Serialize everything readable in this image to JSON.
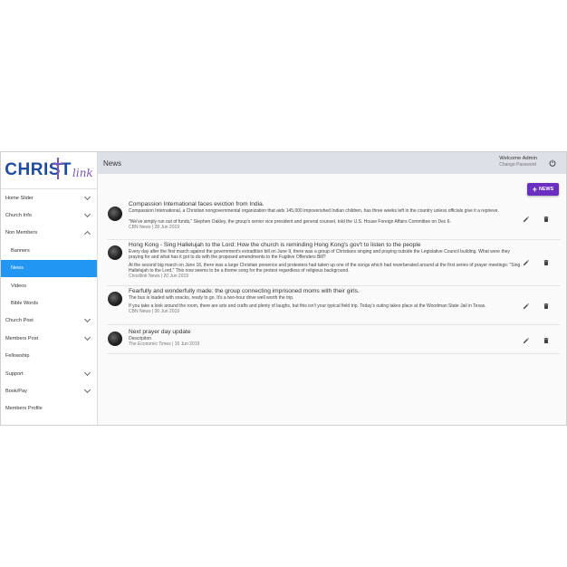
{
  "logo": {
    "main": "CHRIST",
    "script": "link"
  },
  "sidebar": {
    "items": [
      {
        "label": "Home Slider",
        "chevron": "down"
      },
      {
        "label": "Church Info",
        "chevron": "down"
      },
      {
        "label": "Non Members",
        "chevron": "up"
      },
      {
        "label": "Banners",
        "sub": true
      },
      {
        "label": "News",
        "sub": true,
        "active": true
      },
      {
        "label": "Videos",
        "sub": true
      },
      {
        "label": "Bible Words",
        "sub": true
      },
      {
        "label": "Church Post",
        "chevron": "down"
      },
      {
        "label": "Members Post",
        "chevron": "down"
      },
      {
        "label": "Fellowship"
      },
      {
        "label": "Support",
        "chevron": "down"
      },
      {
        "label": "Book/Pay",
        "chevron": "down"
      },
      {
        "label": "Members Profile"
      }
    ]
  },
  "header": {
    "title": "News",
    "welcome": "Welcome Admin",
    "change_password": "Change Password"
  },
  "actions": {
    "add_news_label": "NEWS"
  },
  "news": [
    {
      "title": "Compassion International faces eviction from India.",
      "body1": "Compassion International, a Christian nongovernmental organization that aids 145,000 impoverished Indian children, has three weeks left in the country unless officials give it a reprieve.",
      "body2": "\"We've simply run out of funds,\" Stephen Oakley, the group's senior vice president and general counsel, told the U.S. House Foreign Affairs Committee on Dec 6.",
      "meta": "CBN News | 28 Jun 2019"
    },
    {
      "title": "Hong Kong - Sing Hallelujah to the Lord: How the church is reminding Hong Kong's gov't to listen to the people",
      "body1": "Every day after the first march against the government's extradition bill on June 9, there was a group of Christians singing and praying outside the Legislative Council building. What were they praying for and what has it got to do with the proposed amendments to the Fugitive Offenders Bill?",
      "body2": "At the second big march on June 16, there was a large Christian presence and protesters had taken up one of the songs which had reverberated around at the first series of prayer meetings: \"Sing Hallelujah to the Lord.\" This now seems to be a theme song for the protest regardless of religious background.",
      "meta": "Christlink News | 20 Jun 2019"
    },
    {
      "title": "Fearfully and wonderfully made: the group connecting imprisoned moms with their girls.",
      "body1": "The bus is loaded with snacks, ready to go. It's a two-hour drive well worth the trip.",
      "body2": "If you take a look around the room, there are arts and crafts and plenty of laughs, but this isn't your typical field trip. Today's outing takes place at the Woodman State Jail in Texas.",
      "meta": "CBN News | 30 Jun 2019"
    },
    {
      "title": "Next prayer day update",
      "body1": "Descripiton",
      "body2": "",
      "meta": "The Economic Times | 16 Jun 2019"
    }
  ]
}
